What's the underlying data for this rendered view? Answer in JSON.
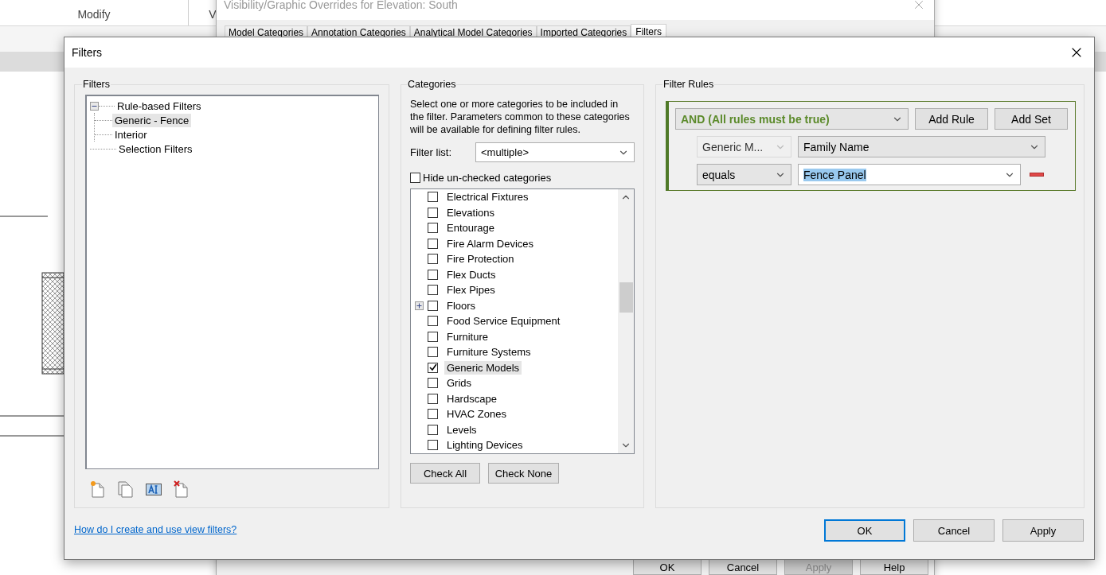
{
  "ribbon": {
    "labels": [
      "Modify",
      "V"
    ]
  },
  "background_dialog": {
    "title": "Visibility/Graphic Overrides for Elevation: South",
    "tabs": [
      {
        "label": "Model Categories",
        "selected": false
      },
      {
        "label": "Annotation Categories",
        "selected": false
      },
      {
        "label": "Analytical Model Categories",
        "selected": false
      },
      {
        "label": "Imported Categories",
        "selected": false
      },
      {
        "label": "Filters",
        "selected": true
      }
    ],
    "buttons": [
      {
        "label": "OK",
        "disabled": false
      },
      {
        "label": "Cancel",
        "disabled": false
      },
      {
        "label": "Apply",
        "disabled": true
      },
      {
        "label": "Help",
        "disabled": false
      }
    ]
  },
  "dialog": {
    "title": "Filters",
    "filters_panel": {
      "title": "Filters",
      "tree": [
        {
          "label": "Rule-based Filters",
          "selected": false,
          "expanded": true,
          "children": [
            {
              "label": "Generic - Fence",
              "selected": true
            },
            {
              "label": "Interior",
              "selected": false
            }
          ]
        },
        {
          "label": "Selection Filters",
          "selected": false
        }
      ]
    },
    "categories_panel": {
      "title": "Categories",
      "description": "Select one or more categories to be included in the filter.  Parameters common to these categories will be available for defining filter rules.",
      "filter_list": {
        "label": "Filter list:",
        "value": "<multiple>"
      },
      "hide_unchecked": {
        "label": "Hide un-checked categories",
        "checked": false
      },
      "items": [
        {
          "label": "Electrical Fixtures",
          "checked": false,
          "selected": false,
          "expandable": false
        },
        {
          "label": "Elevations",
          "checked": false,
          "selected": false,
          "expandable": false
        },
        {
          "label": "Entourage",
          "checked": false,
          "selected": false,
          "expandable": false
        },
        {
          "label": "Fire Alarm Devices",
          "checked": false,
          "selected": false,
          "expandable": false
        },
        {
          "label": "Fire Protection",
          "checked": false,
          "selected": false,
          "expandable": false
        },
        {
          "label": "Flex Ducts",
          "checked": false,
          "selected": false,
          "expandable": false
        },
        {
          "label": "Flex Pipes",
          "checked": false,
          "selected": false,
          "expandable": false
        },
        {
          "label": "Floors",
          "checked": false,
          "selected": false,
          "expandable": true
        },
        {
          "label": "Food Service Equipment",
          "checked": false,
          "selected": false,
          "expandable": false
        },
        {
          "label": "Furniture",
          "checked": false,
          "selected": false,
          "expandable": false
        },
        {
          "label": "Furniture Systems",
          "checked": false,
          "selected": false,
          "expandable": false
        },
        {
          "label": "Generic Models",
          "checked": true,
          "selected": true,
          "expandable": false
        },
        {
          "label": "Grids",
          "checked": false,
          "selected": false,
          "expandable": false
        },
        {
          "label": "Hardscape",
          "checked": false,
          "selected": false,
          "expandable": false
        },
        {
          "label": "HVAC Zones",
          "checked": false,
          "selected": false,
          "expandable": false
        },
        {
          "label": "Levels",
          "checked": false,
          "selected": false,
          "expandable": false
        },
        {
          "label": "Lighting Devices",
          "checked": false,
          "selected": false,
          "expandable": false
        }
      ],
      "buttons": [
        "Check All",
        "Check None"
      ]
    },
    "rules_panel": {
      "title": "Filter Rules",
      "operator": "AND (All rules must be true)",
      "set_buttons": [
        "Add Rule",
        "Add Set"
      ],
      "rules": [
        {
          "category": "Generic M...",
          "category_disabled": true,
          "parameter": "Family Name",
          "condition": "equals",
          "value": "Fence Panel",
          "value_selected": true
        }
      ]
    },
    "help_link": "How do I create and use view filters?",
    "buttons": [
      {
        "label": "OK",
        "focused": true
      },
      {
        "label": "Cancel",
        "focused": false
      },
      {
        "label": "Apply",
        "focused": false
      }
    ]
  }
}
